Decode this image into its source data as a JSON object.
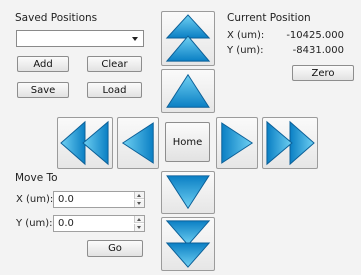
{
  "saved_positions": {
    "title": "Saved Positions",
    "selected": "",
    "add_label": "Add",
    "clear_label": "Clear",
    "save_label": "Save",
    "load_label": "Load"
  },
  "current_position": {
    "title": "Current Position",
    "x_label": "X (um):",
    "x_value": "-10425.000",
    "y_label": "Y (um):",
    "y_value": "-8431.000",
    "zero_label": "Zero"
  },
  "jog": {
    "home_label": "Home"
  },
  "move_to": {
    "title": "Move To",
    "x_label": "X (um):",
    "x_value": "0.0",
    "y_label": "Y (um):",
    "y_value": "0.0",
    "go_label": "Go"
  },
  "colors": {
    "arrow_light": "#6fd0f2",
    "arrow_dark": "#0a7fc4"
  }
}
